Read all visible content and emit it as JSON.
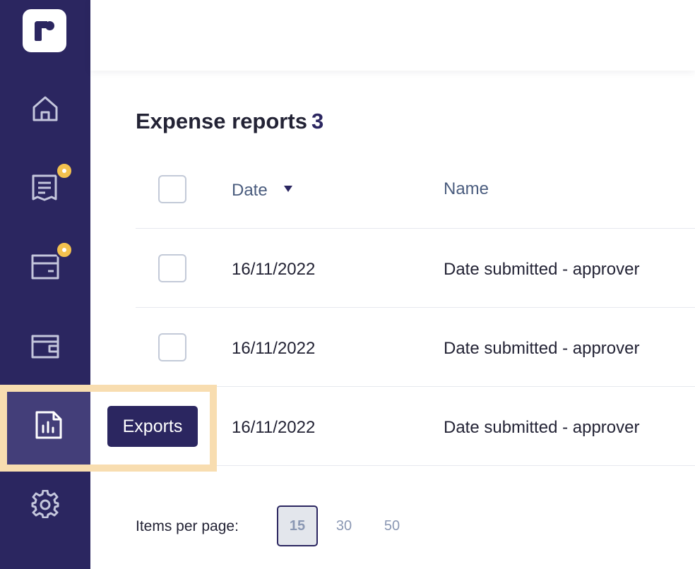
{
  "sidebar": {
    "logo": "roger-logo",
    "items": [
      {
        "name": "home",
        "icon": "home-icon",
        "badge": false
      },
      {
        "name": "receipts",
        "icon": "receipt-icon",
        "badge": true
      },
      {
        "name": "cards",
        "icon": "card-icon",
        "badge": true
      },
      {
        "name": "wallet",
        "icon": "wallet-icon",
        "badge": false
      },
      {
        "name": "exports",
        "icon": "report-chart-icon",
        "badge": false,
        "active": true
      },
      {
        "name": "settings",
        "icon": "gear-icon",
        "badge": false
      }
    ],
    "badge_color": "#f3c14e",
    "background": "#2b2660"
  },
  "tooltip": {
    "label": "Exports"
  },
  "page": {
    "title": "Expense reports",
    "count": "3"
  },
  "table": {
    "columns": {
      "date": "Date",
      "name": "Name"
    },
    "rows": [
      {
        "date": "16/11/2022",
        "name": "Date submitted - approver"
      },
      {
        "date": "16/11/2022",
        "name": "Date submitted - approver"
      },
      {
        "date": "16/11/2022",
        "name": "Date submitted - approver"
      }
    ]
  },
  "pagination": {
    "label": "Items per page:",
    "options": [
      "15",
      "30",
      "50"
    ],
    "selected": "15"
  }
}
